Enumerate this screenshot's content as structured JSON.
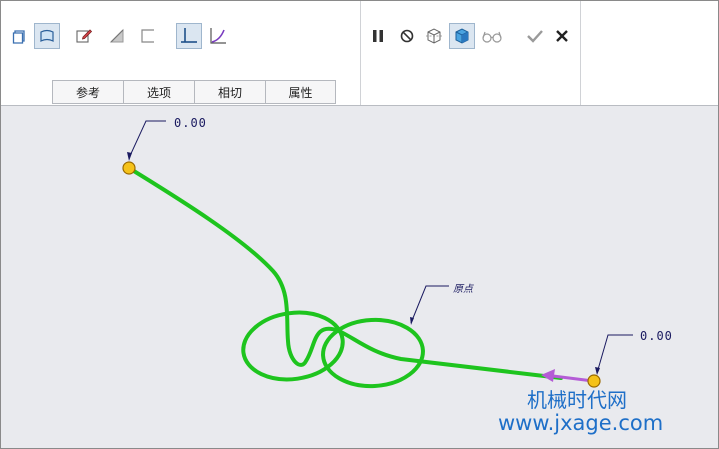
{
  "toolbar": {
    "left_tools": [
      {
        "icon": "solid-cube-icon"
      },
      {
        "icon": "surface-icon",
        "active": true
      },
      {
        "icon": "edit-pencil-icon"
      },
      {
        "icon": "thicken-icon"
      },
      {
        "icon": "open-shape-icon"
      },
      {
        "icon": "straight-tangent-icon",
        "active": true
      },
      {
        "icon": "curvature-icon"
      }
    ],
    "right_tools": [
      {
        "icon": "pause-icon"
      },
      {
        "icon": "no-entry-icon"
      },
      {
        "icon": "wireframe-preview-icon"
      },
      {
        "icon": "shaded-preview-icon",
        "active": true
      },
      {
        "icon": "glasses-preview-icon"
      },
      {
        "icon": "confirm-check-icon"
      },
      {
        "icon": "cancel-x-icon"
      }
    ]
  },
  "tabs": [
    "参考",
    "选项",
    "相切",
    "属性"
  ],
  "canvas": {
    "start_dimension": "0.00",
    "end_dimension": "0.00",
    "curve_label": "原点",
    "colors": {
      "curve": "#1ec41e",
      "endpoint": "#f5c21a",
      "tangent_arrow": "#b45cd6",
      "dimension_text": "#1a1a60"
    }
  },
  "watermark": {
    "line1": "机械时代网",
    "line2": "www.jxage.com"
  }
}
